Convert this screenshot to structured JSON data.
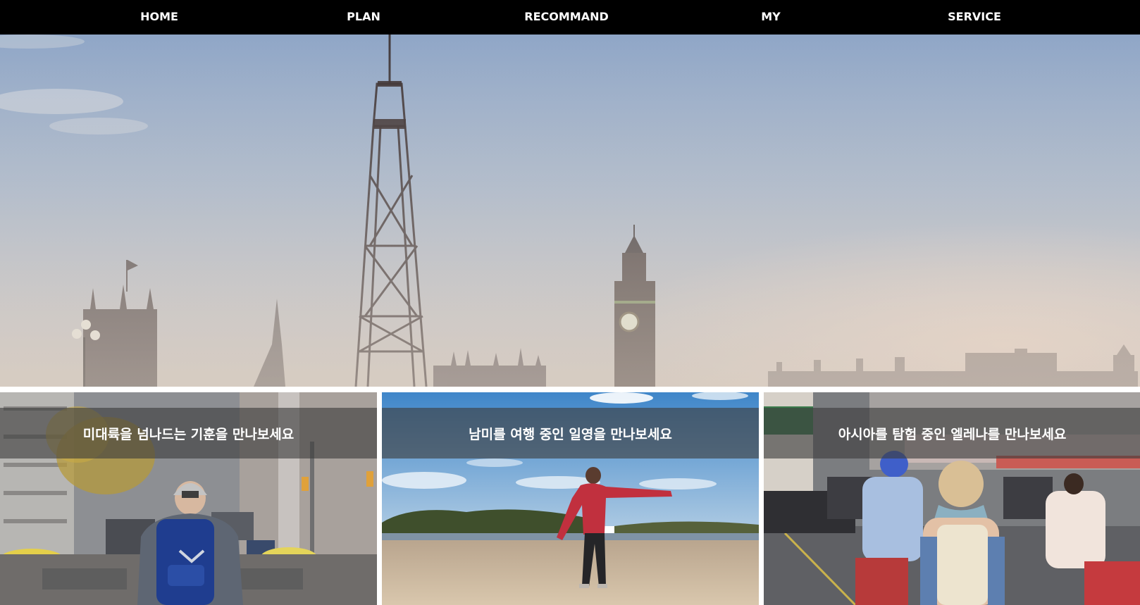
{
  "nav": {
    "items": [
      {
        "label": "HOME"
      },
      {
        "label": "PLAN"
      },
      {
        "label": "RECOMMAND"
      },
      {
        "label": "MY"
      },
      {
        "label": "SERVICE"
      }
    ]
  },
  "cards": [
    {
      "caption": "미대륙을 넘나드는 기훈을 만나보세요"
    },
    {
      "caption": "남미를 여행 중인 일영을 만나보세요"
    },
    {
      "caption": "아시아를 탐험 중인 엘레나를 만나보세요"
    }
  ],
  "colors": {
    "nav_background": "#000000",
    "nav_text": "#ffffff",
    "caption_overlay": "#3c3c3c"
  }
}
